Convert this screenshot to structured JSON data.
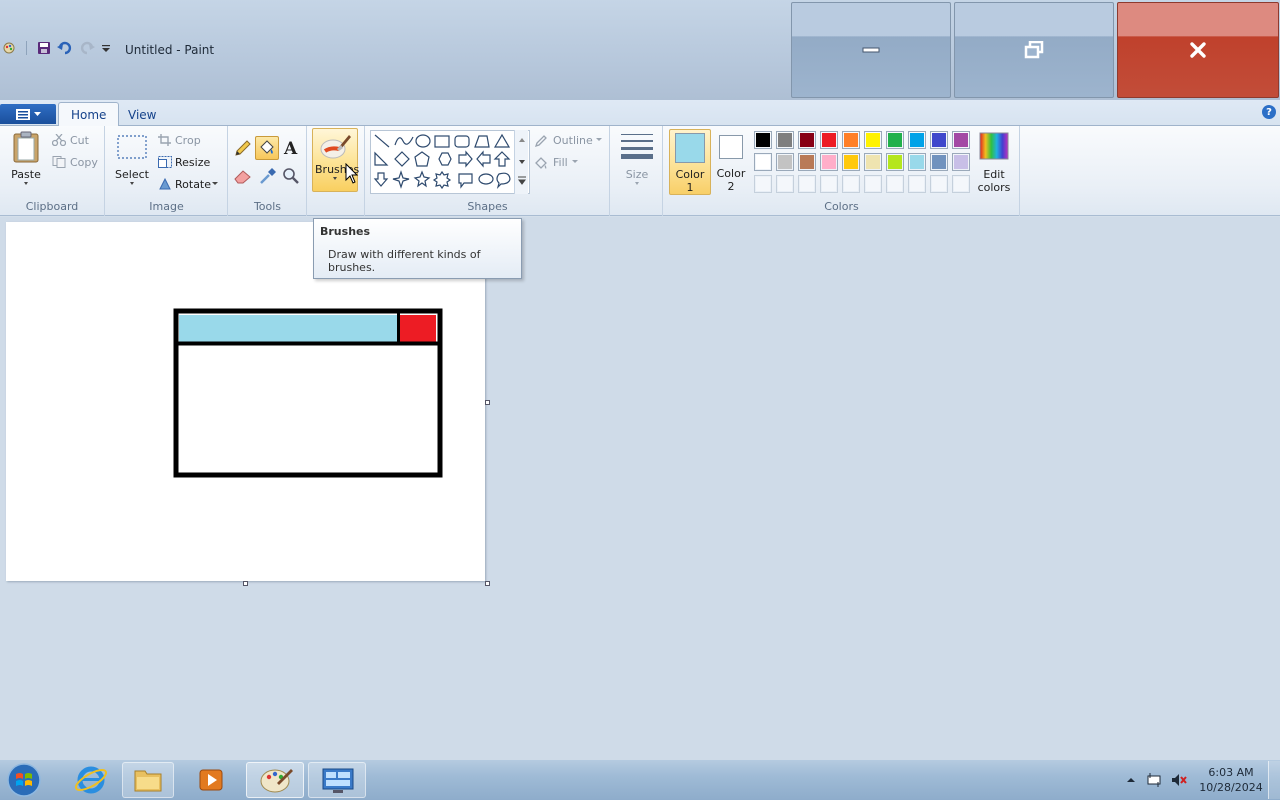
{
  "window": {
    "title": "Untitled - Paint"
  },
  "tabs": {
    "home": "Home",
    "view": "View"
  },
  "help": "?",
  "clipboard": {
    "paste": "Paste",
    "cut": "Cut",
    "copy": "Copy",
    "group": "Clipboard"
  },
  "image": {
    "select": "Select",
    "crop": "Crop",
    "resize": "Resize",
    "rotate": "Rotate",
    "group": "Image"
  },
  "tools": {
    "group": "Tools"
  },
  "brushes": {
    "label": "Brushes"
  },
  "shapes": {
    "outline": "Outline",
    "fill": "Fill",
    "group": "Shapes"
  },
  "size": {
    "label": "Size"
  },
  "colors": {
    "color1_line1": "Color",
    "color1_line2": "1",
    "color2_line1": "Color",
    "color2_line2": "2",
    "edit_line1": "Edit",
    "edit_line2": "colors",
    "group": "Colors",
    "color1_value": "#99d9ea",
    "color2_value": "#ffffff",
    "row1": [
      "#000000",
      "#7f7f7f",
      "#880015",
      "#ed1c24",
      "#ff7f27",
      "#fff200",
      "#22b14c",
      "#00a2e8",
      "#3f48cc",
      "#a349a4"
    ],
    "row2": [
      "#ffffff",
      "#c3c3c3",
      "#b97a57",
      "#ffaec9",
      "#ffc90e",
      "#efe4b0",
      "#b5e61d",
      "#99d9ea",
      "#7092be",
      "#c8bfe7"
    ]
  },
  "tooltip": {
    "title": "Brushes",
    "description": "Draw with different kinds of brushes."
  },
  "drawing": {
    "title_bar_color": "#99d9ea",
    "close_color": "#ed1c24",
    "outline_color": "#000000"
  },
  "clock": {
    "time": "6:03 AM",
    "date": "10/28/2024"
  }
}
